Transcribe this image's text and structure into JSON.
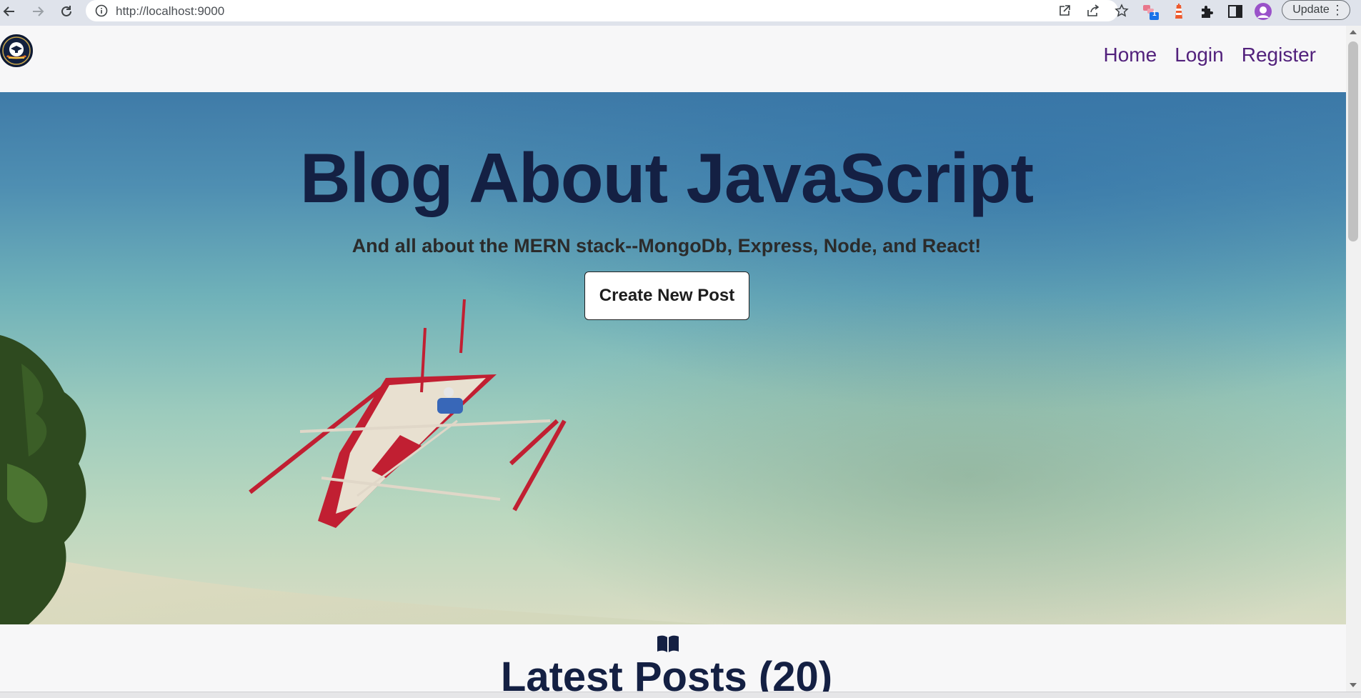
{
  "browser": {
    "url": "http://localhost:9000",
    "update_label": "Update",
    "extension_badge": "1",
    "menu_dots": "⋮"
  },
  "header": {
    "nav": [
      "Home",
      "Login",
      "Register"
    ]
  },
  "hero": {
    "title": "Blog About JavaScript",
    "subtitle": "And all about the MERN stack--MongoDb, Express, Node, and React!",
    "cta_label": "Create New Post"
  },
  "latest": {
    "title": "Latest Posts (20)"
  },
  "colors": {
    "nav_link": "#52217c",
    "heading": "#142043",
    "page_bg": "#f7f7f8"
  }
}
